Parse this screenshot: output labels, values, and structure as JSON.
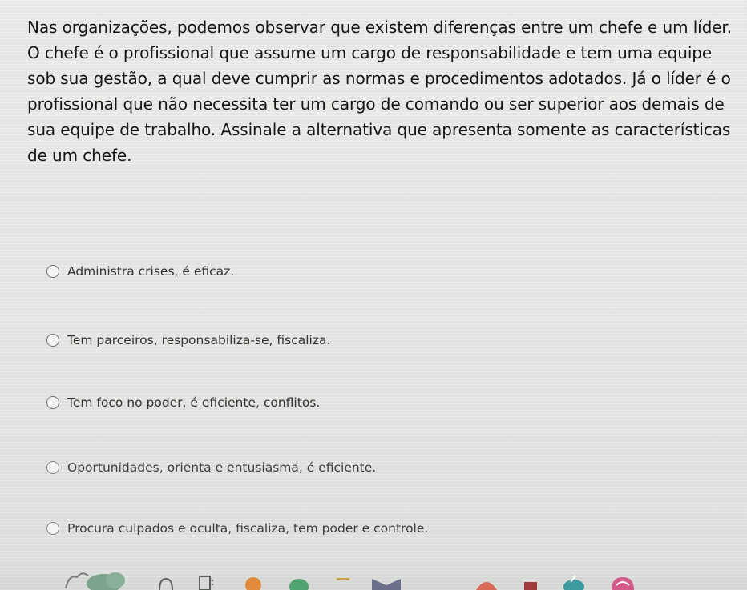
{
  "question": {
    "text": "Nas organizações, podemos observar que existem diferenças entre um chefe e um líder. O chefe é o profissional que assume um cargo de responsabilidade e tem uma equipe sob sua gestão, a qual deve cumprir as normas e procedimentos adotados. Já o líder é o profissional que não necessita ter um cargo de comando ou ser superior aos demais de sua equipe de trabalho. Assinale a alternativa que apresenta somente as características de um chefe."
  },
  "options": [
    {
      "label": "Administra crises, é eficaz."
    },
    {
      "label": "Tem parceiros, responsabiliza-se, fiscaliza."
    },
    {
      "label": "Tem foco no poder, é eficiente, conflitos."
    },
    {
      "label": "Oportunidades, orienta e entusiasma, é eficiente."
    },
    {
      "label": "Procura culpados e oculta, fiscaliza, tem poder e controle."
    }
  ],
  "colors": {
    "background": "#e6e8e4",
    "question_text": "#151515",
    "option_text": "#333333",
    "radio_border": "#6f6f6f"
  },
  "footer_icons": [
    "cloud-icon",
    "arc-icon",
    "card-icon",
    "badge-icon",
    "dome-icon",
    "bar-icon",
    "bowtie-icon",
    "arc-icon",
    "tab-icon",
    "leaf-icon",
    "cup-icon"
  ]
}
